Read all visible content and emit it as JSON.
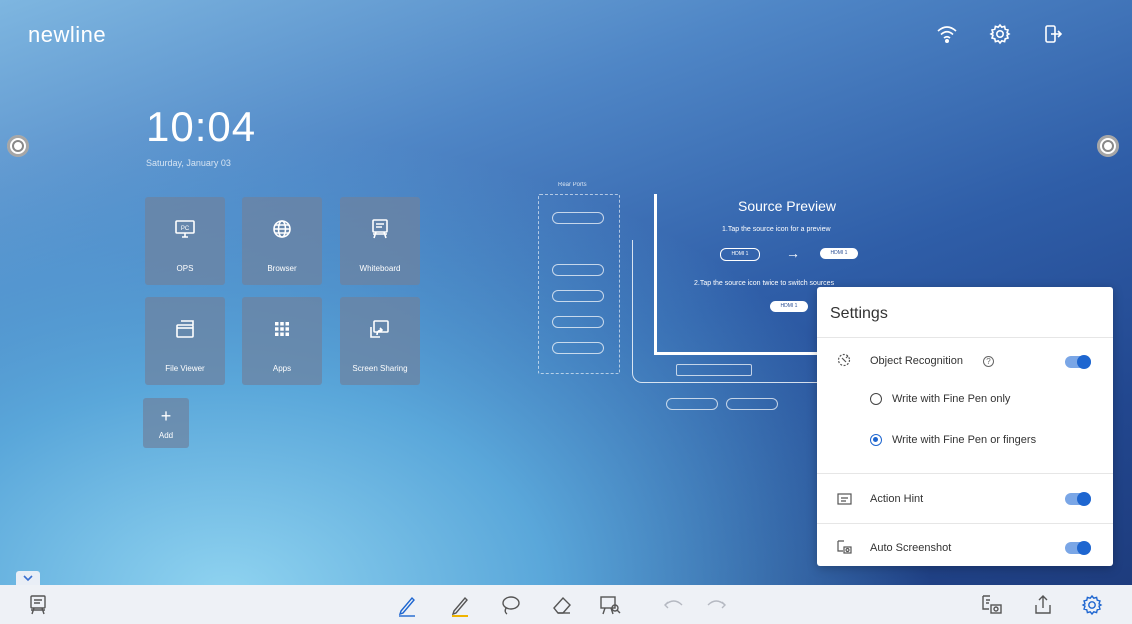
{
  "brand": {
    "logo_text": "newline"
  },
  "top_bar": {
    "icons": [
      "wifi-icon",
      "gear-icon",
      "exit-icon"
    ]
  },
  "home": {
    "time": "10:04",
    "date": "Saturday, January 03",
    "tiles": [
      {
        "label": "OPS",
        "icon": "pc-icon"
      },
      {
        "label": "Browser",
        "icon": "globe-icon"
      },
      {
        "label": "Whiteboard",
        "icon": "whiteboard-icon"
      },
      {
        "label": "File Viewer",
        "icon": "folder-icon"
      },
      {
        "label": "Apps",
        "icon": "apps-grid-icon"
      },
      {
        "label": "Screen Sharing",
        "icon": "screen-share-icon"
      }
    ],
    "add_tile": {
      "label": "Add",
      "symbol": "+"
    }
  },
  "illustration": {
    "ports_title": "Rear Ports",
    "title": "Source Preview",
    "step1": "1.Tap the source icon for a preview",
    "step2": "2.Tap the source icon twice to switch sources",
    "source_label": "HDMI 1"
  },
  "settings": {
    "title": "Settings",
    "object_recognition": {
      "label": "Object Recognition",
      "help_symbol": "?",
      "enabled": true,
      "options": [
        {
          "label": "Write with Fine Pen only",
          "selected": false
        },
        {
          "label": "Write with Fine Pen or fingers",
          "selected": true
        }
      ]
    },
    "action_hint": {
      "label": "Action Hint",
      "enabled": true
    },
    "auto_screenshot": {
      "label": "Auto Screenshot",
      "enabled": true
    }
  },
  "toolbar": {
    "icons": [
      "whiteboard-icon",
      "pen-icon",
      "highlighter-icon",
      "lasso-icon",
      "eraser-icon",
      "present-icon",
      "undo-icon",
      "redo-icon",
      "screenshot-icon",
      "share-icon",
      "settings-icon"
    ]
  },
  "colors": {
    "accent": "#1e66d0",
    "toggle_track": "#7aa6e6",
    "highlighter": "#f0b400"
  }
}
